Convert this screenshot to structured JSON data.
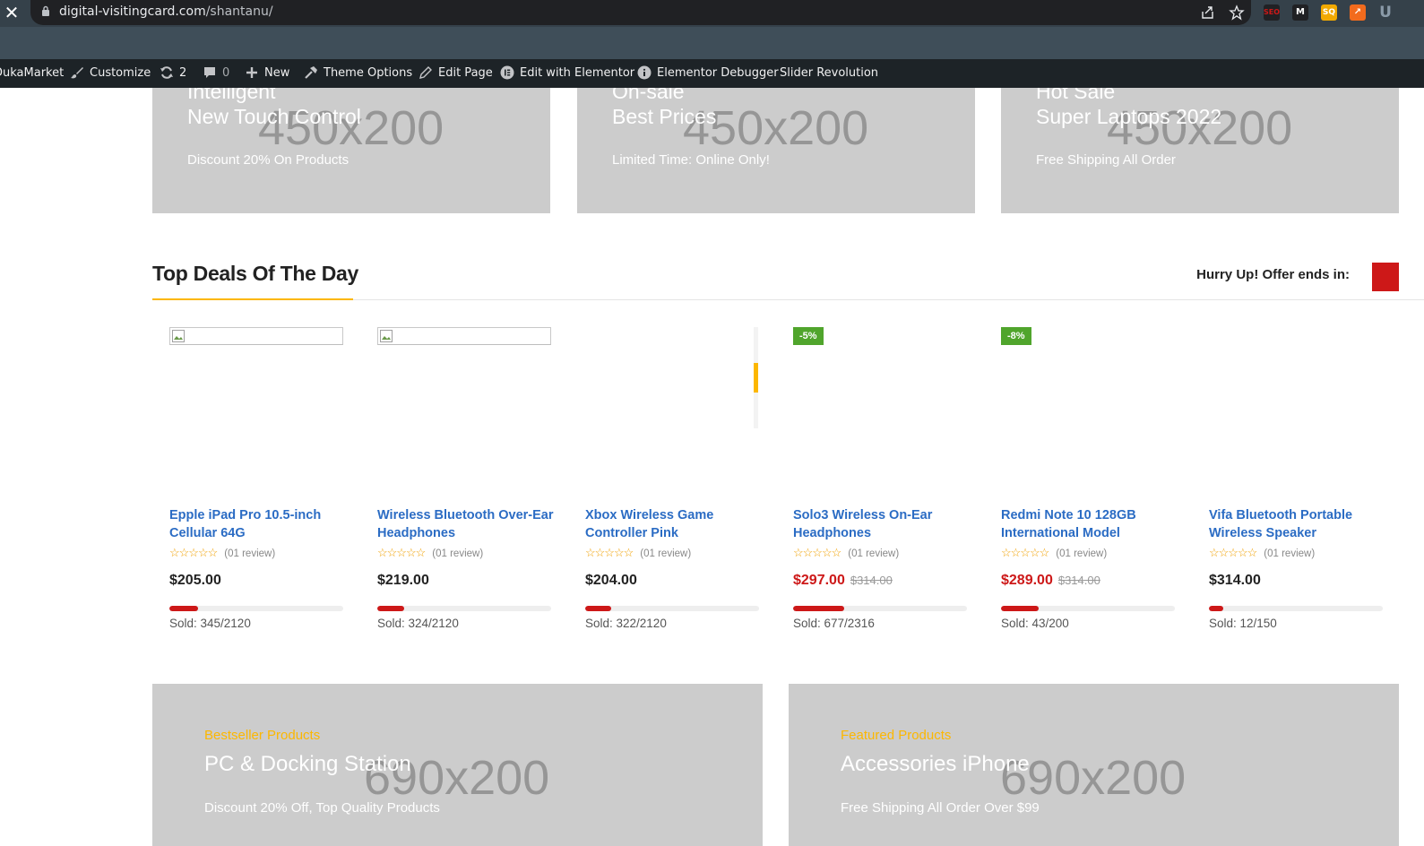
{
  "browser": {
    "close_glyph": "✕",
    "url_domain": "digital-visitingcard.com",
    "url_path": "/shantanu/",
    "icons": [
      "share-icon",
      "star-icon"
    ],
    "extensions": [
      {
        "name": "seo-extension-icon",
        "label": "SEO",
        "color": "#cd1818"
      },
      {
        "name": "m-extension-icon",
        "label": "M",
        "color": "#202124"
      },
      {
        "name": "sq-extension-icon",
        "label": "SQ",
        "color": "#f2a900"
      },
      {
        "name": "trend-extension-icon",
        "label": "↗",
        "color": "#f26b1d"
      },
      {
        "name": "u-extension-icon",
        "label": "U",
        "color": "#8a9aa8"
      }
    ]
  },
  "adminbar": {
    "site": "DukaMarket",
    "customize": "Customize",
    "updates": "2",
    "comments": "0",
    "new": "New",
    "theme_options": "Theme Options",
    "edit_page": "Edit Page",
    "edit_elementor": "Edit with Elementor",
    "debugger": "Elementor Debugger",
    "slider": "Slider Revolution"
  },
  "top_banners": [
    {
      "line1": "Intelligent",
      "line2": "New Touch Control",
      "sub": "Discount 20% On Products",
      "placeholder": "450x200"
    },
    {
      "line1": "On-sale",
      "line2": "Best Prices",
      "sub": "Limited Time: Online Only!",
      "placeholder": "450x200"
    },
    {
      "line1": "Hot Sale",
      "line2": "Super Laptops 2022",
      "sub": "Free Shipping All Order",
      "placeholder": "450x200"
    }
  ],
  "deals": {
    "title": "Top Deals Of The Day",
    "hurry": "Hurry Up! Offer ends in:",
    "accent": "#fcb700",
    "sale_color": "#cd1818"
  },
  "products": [
    {
      "name": "Epple iPad Pro 10.5-inch Cellular 64G",
      "badge": "",
      "stars": "☆☆☆☆☆",
      "reviews": "(01 review)",
      "price": "$205.00",
      "old_price": "",
      "sold_text": "Sold: 345/2120",
      "sold_fraction": 0.163,
      "has_image": true
    },
    {
      "name": "Wireless Bluetooth Over-Ear Headphones",
      "badge": "",
      "stars": "☆☆☆☆☆",
      "reviews": "(01 review)",
      "price": "$219.00",
      "old_price": "",
      "sold_text": "Sold: 324/2120",
      "sold_fraction": 0.153,
      "has_image": true
    },
    {
      "name": "Xbox Wireless Game Controller Pink",
      "badge": "",
      "stars": "☆☆☆☆☆",
      "reviews": "(01 review)",
      "price": "$204.00",
      "old_price": "",
      "sold_text": "Sold: 322/2120",
      "sold_fraction": 0.152,
      "has_image": false
    },
    {
      "name": "Solo3 Wireless On-Ear Headphones",
      "badge": "-5%",
      "stars": "☆☆☆☆☆",
      "reviews": "(01 review)",
      "price": "$297.00",
      "old_price": "$314.00",
      "sold_text": "Sold: 677/2316",
      "sold_fraction": 0.292,
      "has_image": false
    },
    {
      "name": "Redmi Note 10 128GB International Model",
      "badge": "-8%",
      "stars": "☆☆☆☆☆",
      "reviews": "(01 review)",
      "price": "$289.00",
      "old_price": "$314.00",
      "sold_text": "Sold: 43/200",
      "sold_fraction": 0.215,
      "has_image": false
    },
    {
      "name": "Vifa Bluetooth Portable Wireless Speaker",
      "badge": "",
      "stars": "☆☆☆☆☆",
      "reviews": "(01 review)",
      "price": "$314.00",
      "old_price": "",
      "sold_text": "Sold: 12/150",
      "sold_fraction": 0.08,
      "has_image": false
    }
  ],
  "bottom_banners": [
    {
      "eyebrow": "Bestseller Products",
      "title": "PC & Docking Station",
      "sub": "Discount 20% Off, Top Quality Products",
      "placeholder": "690x200"
    },
    {
      "eyebrow": "Featured Products",
      "title": "Accessories iPhone",
      "sub": "Free Shipping All Order Over $99",
      "placeholder": "690x200"
    }
  ]
}
